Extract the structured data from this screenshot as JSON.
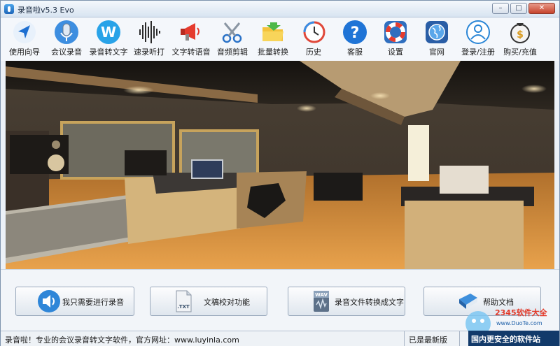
{
  "window": {
    "title": "录音啦v5.3 Evo",
    "minimize": "–",
    "maximize": "□",
    "close": "✕"
  },
  "toolbar": [
    {
      "label": "使用向导",
      "icon": "navigation-arrow-icon"
    },
    {
      "label": "会议录音",
      "icon": "microphone-icon"
    },
    {
      "label": "录音转文字",
      "icon": "w-letter-icon"
    },
    {
      "label": "速录听打",
      "icon": "waveform-icon"
    },
    {
      "label": "文字转语音",
      "icon": "megaphone-icon"
    },
    {
      "label": "音频剪辑",
      "icon": "scissors-icon"
    },
    {
      "label": "批量转换",
      "icon": "folder-icon"
    },
    {
      "label": "历史",
      "icon": "history-clock-icon"
    },
    {
      "label": "客服",
      "icon": "help-icon"
    },
    {
      "label": "设置",
      "icon": "lifebuoy-settings-icon"
    },
    {
      "label": "官网",
      "icon": "globe-icon"
    },
    {
      "label": "登录/注册",
      "icon": "user-icon"
    },
    {
      "label": "购买/充值",
      "icon": "money-bag-icon"
    }
  ],
  "actions": {
    "record": "我只需要进行录音",
    "proofread": "文稿校对功能",
    "proofread_badge": ".TXT",
    "convert": "录音文件转换成文字",
    "convert_badge": "WAV",
    "help": "帮助文档"
  },
  "status": {
    "left": "录音啦！专业的会议录音转文字软件，官方网址：www.luyinla.com",
    "right": "已是最新版本！"
  },
  "watermark": {
    "brand": "2345软件大全",
    "url": "www.DuoTe.com",
    "slogan": "国内更安全的软件站"
  },
  "colors": {
    "accent": "#2f7fd0",
    "titlebar": "#d8e4f1",
    "close": "#c6432c"
  }
}
